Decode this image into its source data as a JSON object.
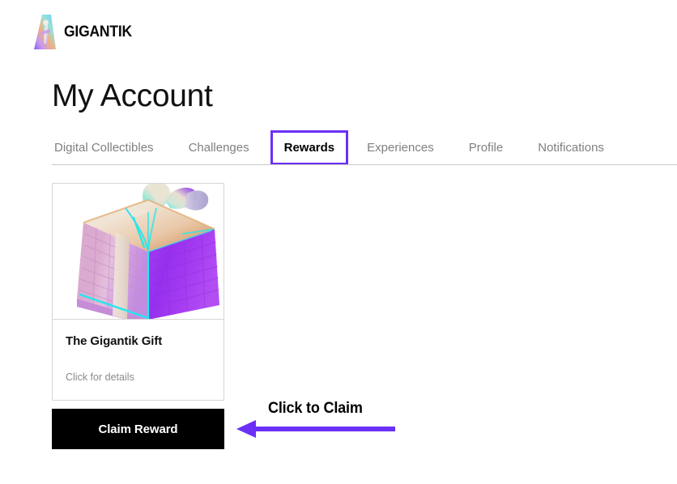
{
  "brand": {
    "name": "GIGANTIK",
    "logo_icon": "gigantik-gradient-monument-logo",
    "logo_colors": [
      "#f0a878",
      "#c59af0",
      "#7ad8f0",
      "#b0f0d8",
      "#8a5ef0"
    ]
  },
  "page": {
    "title": "My Account"
  },
  "tabs": [
    {
      "label": "Digital Collectibles",
      "active": false
    },
    {
      "label": "Challenges",
      "active": false
    },
    {
      "label": "Rewards",
      "active": true
    },
    {
      "label": "Experiences",
      "active": false
    },
    {
      "label": "Profile",
      "active": false
    },
    {
      "label": "Notifications",
      "active": false
    }
  ],
  "reward_card": {
    "image_alt": "3d-gift-box-with-bow",
    "title": "The Gigantik Gift",
    "subtitle": "Click for details",
    "claim_label": "Claim Reward"
  },
  "annotation": {
    "label": "Click to Claim",
    "arrow_direction": "left",
    "arrow_color": "#6b30f5"
  },
  "colors": {
    "accent_purple": "#6b30f5",
    "button_bg": "#000000",
    "button_text": "#ffffff",
    "tab_inactive": "#808080",
    "tab_active": "#000000",
    "divider": "#c9c9c9",
    "card_border": "#d6d6d6",
    "muted_text": "#8a8a8a"
  }
}
